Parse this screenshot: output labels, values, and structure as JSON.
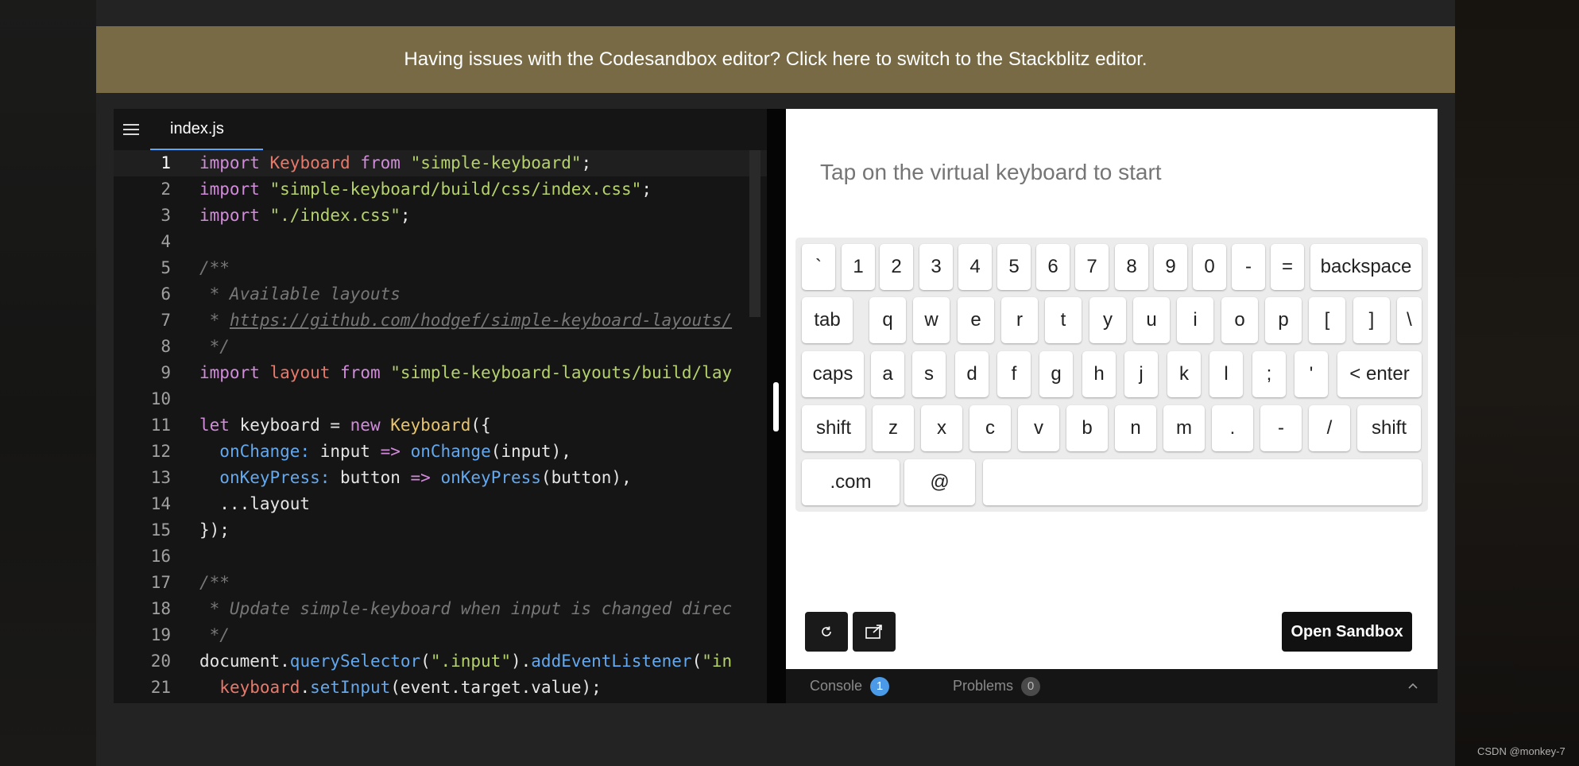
{
  "banner": {
    "text": "Having issues with the Codesandbox editor? Click here to switch to the Stackblitz editor."
  },
  "editor": {
    "file_tab": "index.js",
    "lines": [
      [
        {
          "t": "import",
          "c": "kw"
        },
        {
          "t": " "
        },
        {
          "t": "Keyboard",
          "c": "var"
        },
        {
          "t": " "
        },
        {
          "t": "from",
          "c": "kw"
        },
        {
          "t": " "
        },
        {
          "t": "\"simple-keyboard\"",
          "c": "str"
        },
        {
          "t": ";"
        }
      ],
      [
        {
          "t": "import",
          "c": "kw"
        },
        {
          "t": " "
        },
        {
          "t": "\"simple-keyboard/build/css/index.css\"",
          "c": "str"
        },
        {
          "t": ";"
        }
      ],
      [
        {
          "t": "import",
          "c": "kw"
        },
        {
          "t": " "
        },
        {
          "t": "\"./index.css\"",
          "c": "str"
        },
        {
          "t": ";"
        }
      ],
      [],
      [
        {
          "t": "/**",
          "c": "cmt"
        }
      ],
      [
        {
          "t": " * Available layouts",
          "c": "cmt"
        }
      ],
      [
        {
          "t": " * ",
          "c": "cmt"
        },
        {
          "t": "https://github.com/hodgef/simple-keyboard-layouts/",
          "c": "cmt url"
        }
      ],
      [
        {
          "t": " */",
          "c": "cmt"
        }
      ],
      [
        {
          "t": "import",
          "c": "kw"
        },
        {
          "t": " "
        },
        {
          "t": "layout",
          "c": "var"
        },
        {
          "t": " "
        },
        {
          "t": "from",
          "c": "kw"
        },
        {
          "t": " "
        },
        {
          "t": "\"simple-keyboard-layouts/build/lay",
          "c": "str"
        }
      ],
      [],
      [
        {
          "t": "let",
          "c": "kw"
        },
        {
          "t": " keyboard = "
        },
        {
          "t": "new",
          "c": "kw"
        },
        {
          "t": " "
        },
        {
          "t": "Keyboard",
          "c": "cls"
        },
        {
          "t": "({"
        }
      ],
      [
        {
          "t": "  "
        },
        {
          "t": "onChange:",
          "c": "fn"
        },
        {
          "t": " input "
        },
        {
          "t": "=>",
          "c": "kw"
        },
        {
          "t": " "
        },
        {
          "t": "onChange",
          "c": "fn"
        },
        {
          "t": "(input),"
        }
      ],
      [
        {
          "t": "  "
        },
        {
          "t": "onKeyPress:",
          "c": "fn"
        },
        {
          "t": " button "
        },
        {
          "t": "=>",
          "c": "kw"
        },
        {
          "t": " "
        },
        {
          "t": "onKeyPress",
          "c": "fn"
        },
        {
          "t": "(button),"
        }
      ],
      [
        {
          "t": "  ...layout"
        }
      ],
      [
        {
          "t": "});"
        }
      ],
      [],
      [
        {
          "t": "/**",
          "c": "cmt"
        }
      ],
      [
        {
          "t": " * Update simple-keyboard when input is changed direc",
          "c": "cmt"
        }
      ],
      [
        {
          "t": " */",
          "c": "cmt"
        }
      ],
      [
        {
          "t": "document."
        },
        {
          "t": "querySelector",
          "c": "fn"
        },
        {
          "t": "("
        },
        {
          "t": "\".input\"",
          "c": "str"
        },
        {
          "t": ")."
        },
        {
          "t": "addEventListener",
          "c": "fn"
        },
        {
          "t": "("
        },
        {
          "t": "\"in",
          "c": "str"
        }
      ],
      [
        {
          "t": "  "
        },
        {
          "t": "keyboard",
          "c": "var"
        },
        {
          "t": "."
        },
        {
          "t": "setInput",
          "c": "fn"
        },
        {
          "t": "(event.target.value);"
        }
      ]
    ]
  },
  "preview": {
    "input_placeholder": "Tap on the virtual keyboard to start",
    "keyboard_rows": [
      [
        "`",
        "1",
        "2",
        "3",
        "4",
        "5",
        "6",
        "7",
        "8",
        "9",
        "0",
        "-",
        "=",
        "backspace"
      ],
      [
        "tab",
        "q",
        "w",
        "e",
        "r",
        "t",
        "y",
        "u",
        "i",
        "o",
        "p",
        "[",
        "]",
        "\\"
      ],
      [
        "caps",
        "a",
        "s",
        "d",
        "f",
        "g",
        "h",
        "j",
        "k",
        "l",
        ";",
        "'",
        "< enter"
      ],
      [
        "shift",
        "z",
        "x",
        "c",
        "v",
        "b",
        "n",
        "m",
        ".",
        "-",
        "/",
        "shift"
      ],
      [
        ".com",
        "@",
        ""
      ]
    ],
    "open_sandbox_label": "Open Sandbox"
  },
  "console_bar": {
    "console_label": "Console",
    "console_count": "1",
    "problems_label": "Problems",
    "problems_count": "0"
  },
  "watermark": "CSDN @monkey-7",
  "colors": {
    "banner": "#776a44",
    "accent": "#4a9ae8"
  }
}
